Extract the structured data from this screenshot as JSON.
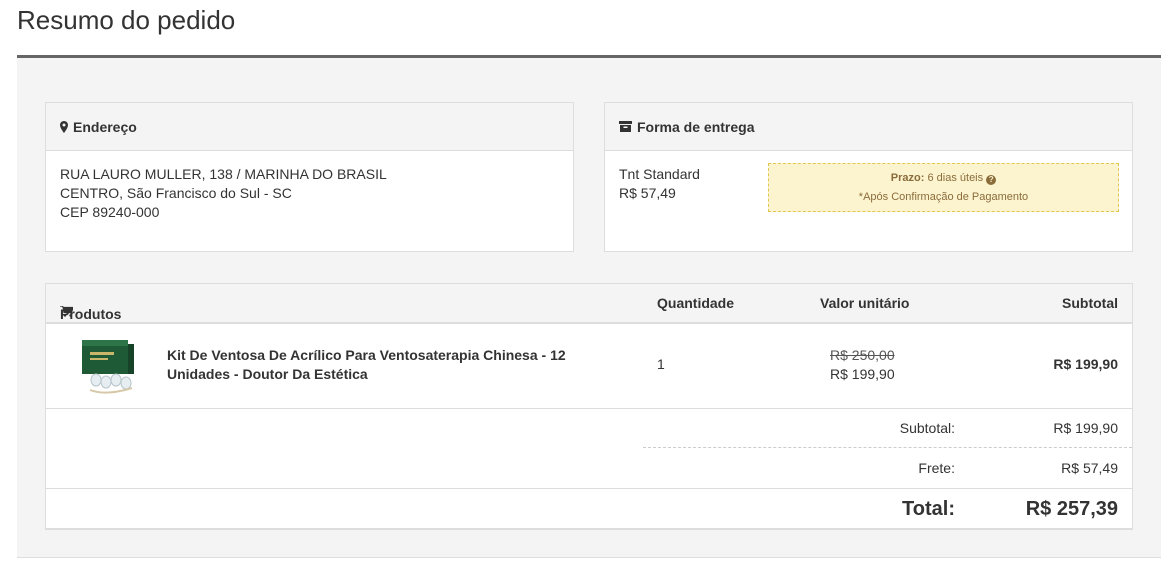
{
  "page": {
    "title": "Resumo do pedido"
  },
  "address": {
    "heading": "Endereço",
    "line1": "RUA LAURO MULLER, 138 / MARINHA DO BRASIL",
    "line2": "CENTRO, São Francisco do Sul - SC",
    "line3": "CEP 89240-000"
  },
  "shipping": {
    "heading": "Forma de entrega",
    "method": "Tnt Standard",
    "price": "R$ 57,49",
    "prazo_label": "Prazo:",
    "prazo_value": "6 dias úteis",
    "note": "*Após Confirmação de Pagamento"
  },
  "products": {
    "headers": {
      "product": "Produtos",
      "quantity": "Quantidade",
      "unit_price": "Valor unitário",
      "subtotal": "Subtotal"
    },
    "items": [
      {
        "name": "Kit De Ventosa De Acrílico Para Ventosaterapia Chinesa - 12 Unidades - Doutor Da Estética",
        "quantity": "1",
        "old_price": "R$ 250,00",
        "price": "R$ 199,90",
        "subtotal": "R$ 199,90"
      }
    ]
  },
  "totals": {
    "subtotal_label": "Subtotal:",
    "subtotal_value": "R$ 199,90",
    "frete_label": "Frete:",
    "frete_value": "R$ 57,49",
    "total_label": "Total:",
    "total_value": "R$ 257,39"
  },
  "colors": {
    "accent_border": "#666666",
    "notice_bg": "#fcf3cf",
    "notice_text": "#8a6d3b"
  },
  "icons": {
    "address": "map-marker-icon",
    "shipping": "archive-box-icon",
    "products": "shopping-cart-icon",
    "help": "question-circle-icon"
  }
}
